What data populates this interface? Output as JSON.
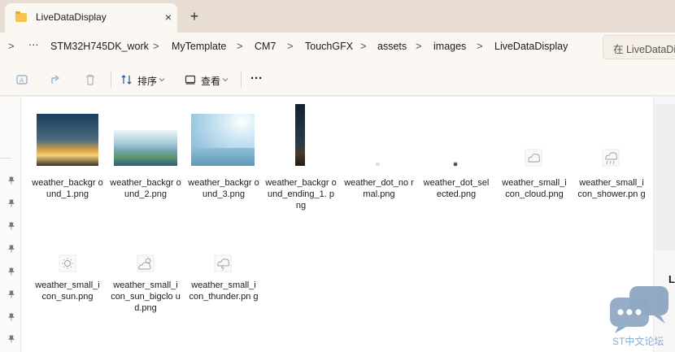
{
  "tab": {
    "title": "LiveDataDisplay",
    "close_icon": "×",
    "new_tab": "+"
  },
  "address": {
    "lead_chevron": ">",
    "more": "···",
    "crumbs": [
      "STM32H745DK_work",
      "MyTemplate",
      "CM7",
      "TouchGFX",
      "assets",
      "images",
      "LiveDataDisplay"
    ],
    "sep": ">",
    "search_placeholder": "在 LiveDataDisplay 中搜索"
  },
  "toolbar": {
    "sort_label": "排序",
    "view_label": "查看",
    "more": "···"
  },
  "files": [
    {
      "name": "weather_backgr ound_1.png",
      "thumb": "bg1"
    },
    {
      "name": "weather_backgr ound_2.png",
      "thumb": "bg2"
    },
    {
      "name": "weather_backgr ound_3.png",
      "thumb": "bg3"
    },
    {
      "name": "weather_backgr ound_ending_1. png",
      "thumb": "ending"
    },
    {
      "name": "weather_dot_no rmal.png",
      "thumb": "dot-normal"
    },
    {
      "name": "weather_dot_sel ected.png",
      "thumb": "dot-selected"
    },
    {
      "name": "weather_small_i con_cloud.png",
      "thumb": "cloud-icon"
    },
    {
      "name": "weather_small_i con_shower.pn g",
      "thumb": "shower-icon"
    },
    {
      "name": "weather_small_i con_sun.png",
      "thumb": "sun-icon"
    },
    {
      "name": "weather_small_i con_sun_bigclo ud.png",
      "thumb": "sun-bigcloud-icon"
    },
    {
      "name": "weather_small_i con_thunder.pn g",
      "thumb": "thunder-icon"
    }
  ],
  "right_panel": {
    "label": "L"
  },
  "watermark": {
    "text": "ST中文论坛"
  },
  "colors": {
    "accent": "#0067c0",
    "tab_bg": "#e8ddd2",
    "bar_bg": "#fbf7f3"
  }
}
